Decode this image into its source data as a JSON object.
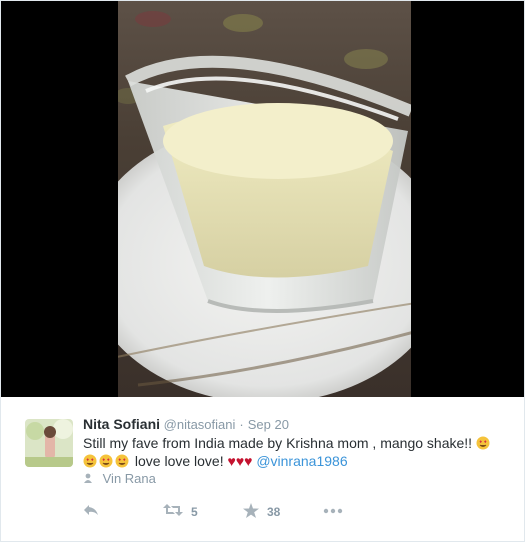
{
  "tweet": {
    "name": "Nita Sofiani",
    "handle": "@nitasofiani",
    "date": "Sep 20",
    "text_line1": "Still my fave from India made by Krishna mom , mango shake!!",
    "text_line2": "love love love!",
    "mention": "@vinrana1986",
    "place": "Vin Rana",
    "retweets": "5",
    "favorites": "38"
  },
  "icons": {
    "reply": "reply-icon",
    "retweet": "retweet-icon",
    "favorite": "star-icon",
    "more": "more-icon",
    "place": "person-icon",
    "emoji": "heart-eyes-emoji",
    "heart": "red-heart-emoji"
  },
  "colors": {
    "link": "#3b94d9",
    "heart": "#c4122f",
    "muted": "#8899a6"
  }
}
